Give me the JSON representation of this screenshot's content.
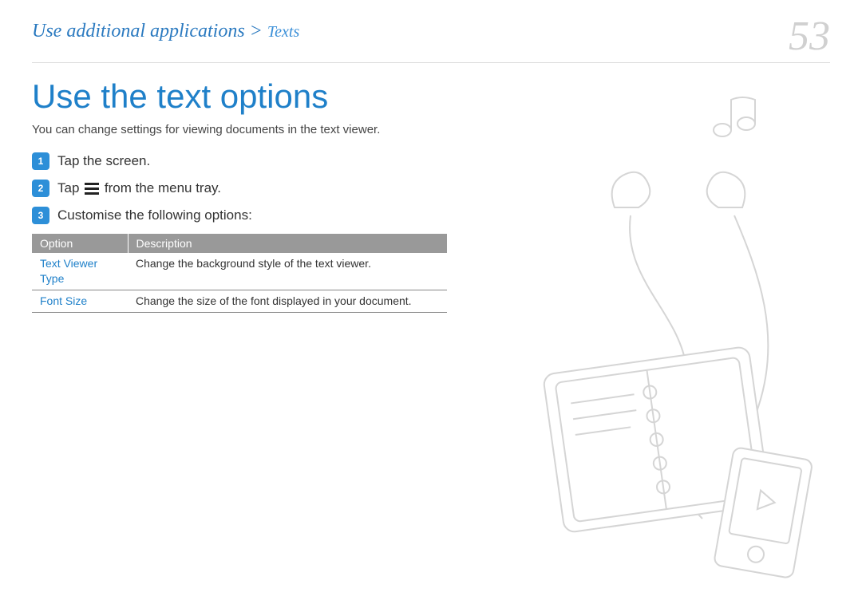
{
  "breadcrumb": {
    "main": "Use additional applications",
    "separator": " > ",
    "sub": "Texts"
  },
  "page_number": "53",
  "title": "Use the text options",
  "intro": "You can change settings for viewing documents in the text viewer.",
  "steps": [
    {
      "num": "1",
      "text": "Tap the screen."
    },
    {
      "num": "2",
      "text_before": "Tap ",
      "text_after": " from the menu tray."
    },
    {
      "num": "3",
      "text": "Customise the following options:"
    }
  ],
  "table": {
    "headers": {
      "option": "Option",
      "description": "Description"
    },
    "rows": [
      {
        "option": "Text Viewer Type",
        "description": "Change the background style of the text viewer."
      },
      {
        "option": "Font Size",
        "description": "Change the size of the font displayed in your document."
      }
    ]
  }
}
